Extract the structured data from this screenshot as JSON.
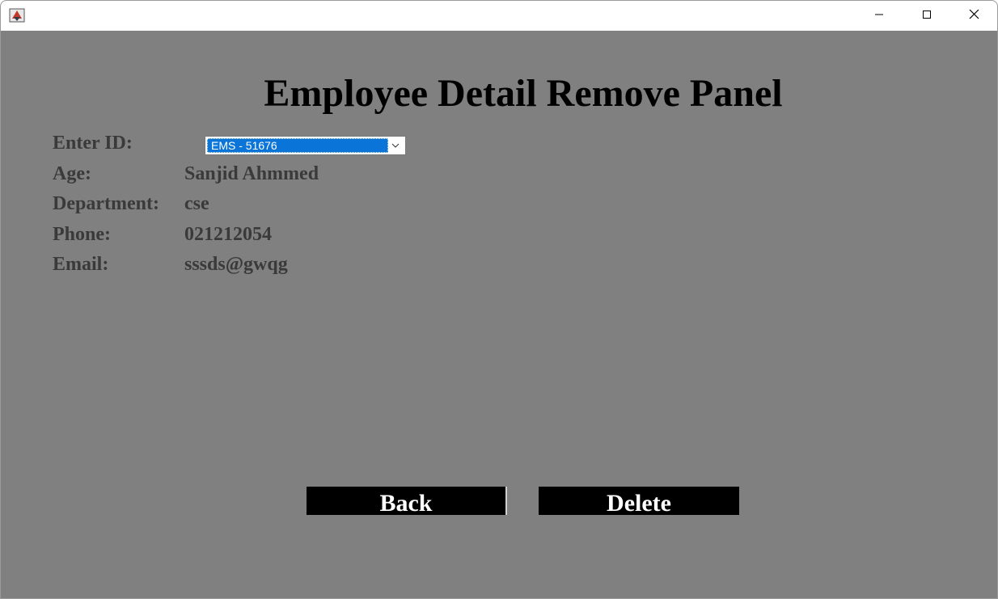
{
  "window": {
    "title": "",
    "controls": {
      "minimize": "minimize",
      "maximize": "maximize",
      "close": "close"
    }
  },
  "panel": {
    "heading": "Employee Detail Remove Panel"
  },
  "form": {
    "id_label": "Enter ID:",
    "id_selected": "EMS - 51676",
    "age_label": "Age:",
    "age_value": "Sanjid Ahmmed",
    "department_label": "Department:",
    "department_value": "cse",
    "phone_label": "Phone:",
    "phone_value": "021212054",
    "email_label": "Email:",
    "email_value": "sssds@gwqg"
  },
  "buttons": {
    "back_label": "Back",
    "delete_label": "Delete"
  },
  "colors": {
    "background": "#808080",
    "button_bg": "#000000",
    "selection": "#0a74d8"
  }
}
